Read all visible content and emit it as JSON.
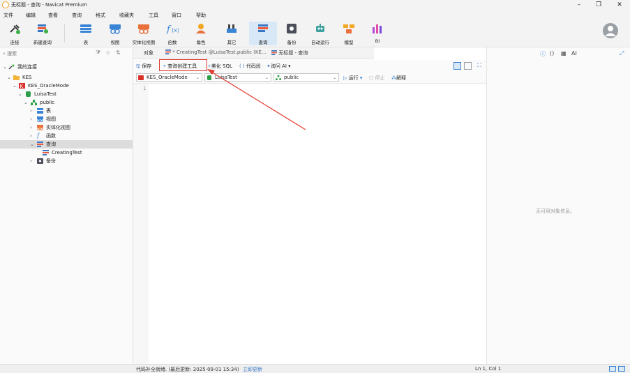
{
  "window": {
    "title": "无标题 - 查询 - Navicat Premium"
  },
  "menu": [
    "文件",
    "编辑",
    "查看",
    "查询",
    "格式",
    "收藏夹",
    "工具",
    "窗口",
    "帮助"
  ],
  "toolbar": {
    "connect": "连接",
    "new_query": "新建查询",
    "table": "表",
    "view": "视图",
    "mview": "实体化视图",
    "function": "函数",
    "role": "角色",
    "other": "其它",
    "query": "查询",
    "backup": "备份",
    "automation": "自动运行",
    "model": "模型",
    "bi": "BI"
  },
  "nav": {
    "search_placeholder": "搜索",
    "tree": {
      "my_connections": "我的连接",
      "kes": "KES",
      "kes_oraclemode": "KES_OracleMode",
      "luisatest": "LuisaTest",
      "public": "public",
      "tables": "表",
      "views": "视图",
      "mviews": "实体化视图",
      "functions": "函数",
      "queries": "查询",
      "creatingtest": "CreatingTest",
      "backups": "备份"
    }
  },
  "tabs": {
    "objects": "对象",
    "tab1": "* CreatingTest @LuisaTest.public (KE...",
    "tab2": "无标题 - 查询"
  },
  "query_toolbar": {
    "save": "保存",
    "query_builder": "查询创建工具",
    "beautify": "美化 SQL",
    "snippet": "代码段",
    "ask_ai": "询问 AI"
  },
  "query_bar2": {
    "connection": "KES_OracleMode",
    "database": "LuisaTest",
    "schema": "public",
    "run": "运行",
    "stop": "停止",
    "explain": "解释"
  },
  "editor": {
    "line_number": "1"
  },
  "right_panel": {
    "empty_message": "无可用对象信息。",
    "ai_label": "AI"
  },
  "status": {
    "info": "代码补全就绪. (最后更新: 2025-09-01 15:34)",
    "update_link": "立即更新",
    "cursor": "Ln 1, Col 1"
  },
  "colors": {
    "accent": "#2f7ed8",
    "highlight_red": "#e43a2f",
    "selected_row": "#dcdcdc"
  }
}
